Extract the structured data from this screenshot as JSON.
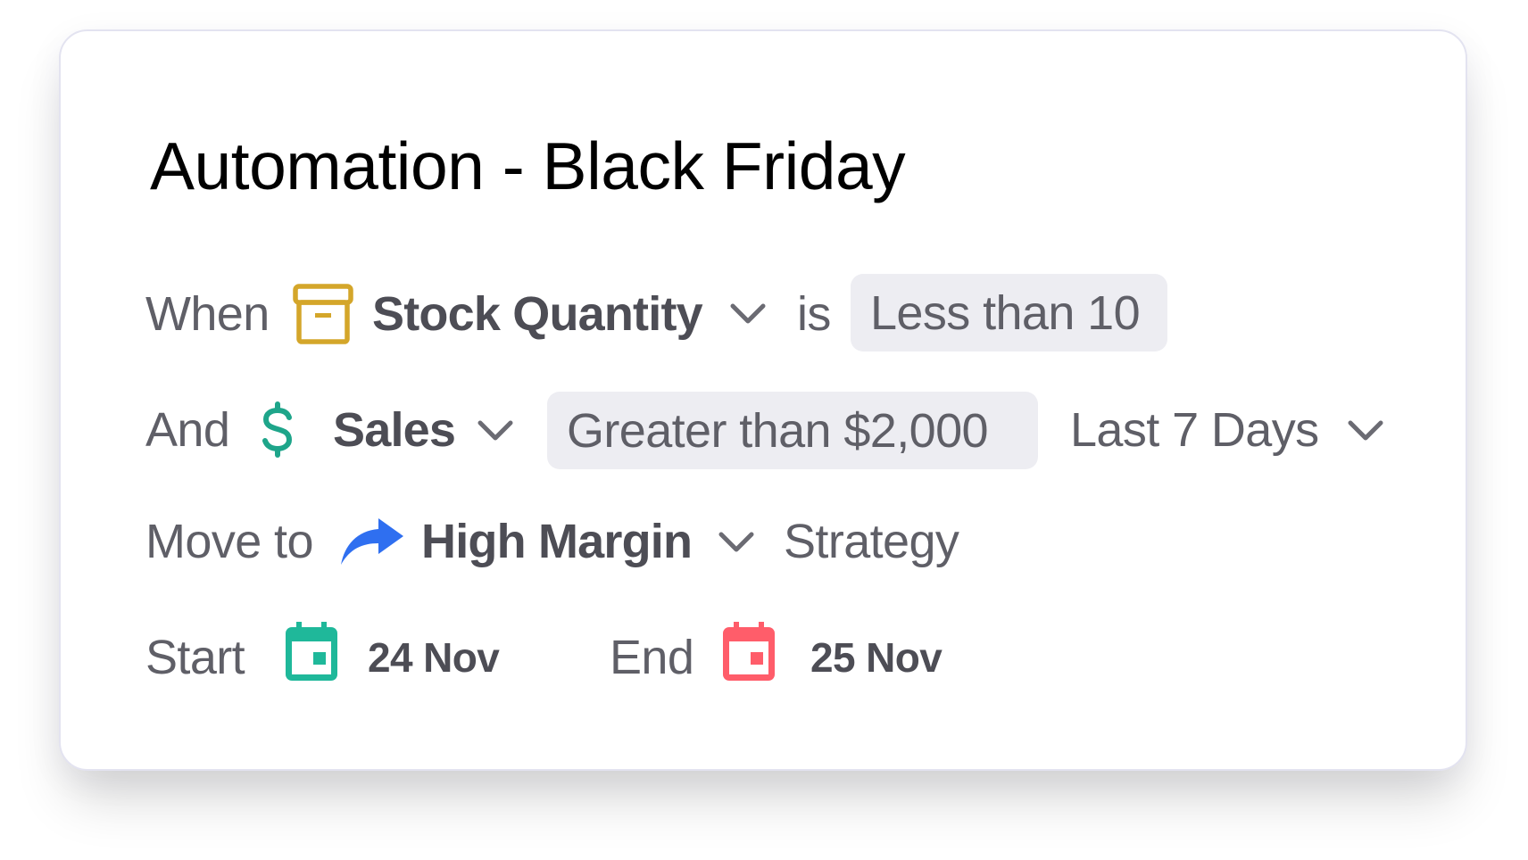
{
  "title": "Automation - Black Friday",
  "colors": {
    "archive": "#d4a62a",
    "dollar": "#1ea58a",
    "arrow": "#2f6ff0",
    "start_calendar": "#1fb89a",
    "end_calendar": "#ff5d6a",
    "chip_bg": "#ededf2",
    "label": "#5f5f67",
    "value": "#4d4d55"
  },
  "rows": {
    "when": {
      "label": "When",
      "icon": "archive-box-icon",
      "field": "Stock Quantity",
      "connector": "is",
      "condition": "Less than 10"
    },
    "and": {
      "label": "And",
      "icon": "dollar-icon",
      "field": "Sales",
      "condition": "Greater than $2,000",
      "period": "Last 7 Days"
    },
    "move": {
      "label": "Move to",
      "icon": "forward-arrow-icon",
      "target": "High Margin",
      "suffix": "Strategy"
    },
    "schedule": {
      "start_label": "Start",
      "start_icon": "calendar-icon",
      "start_date": "24 Nov",
      "end_label": "End",
      "end_icon": "calendar-icon",
      "end_date": "25 Nov"
    }
  }
}
